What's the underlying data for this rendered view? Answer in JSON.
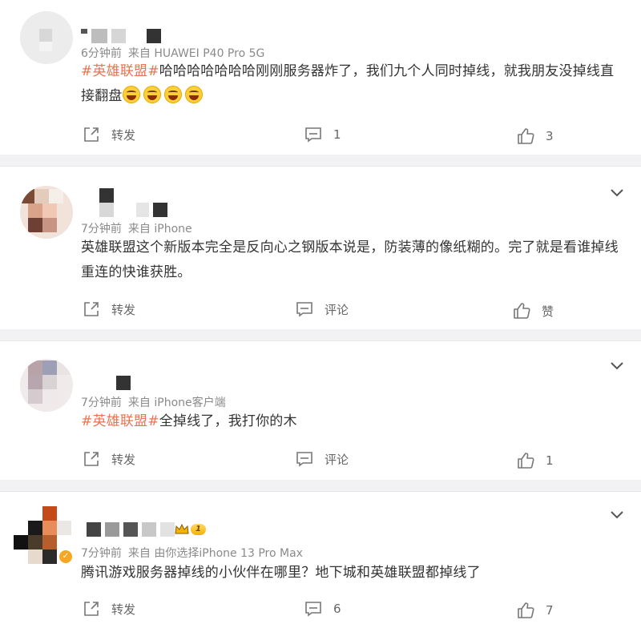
{
  "posts": [
    {
      "time": "6分钟前",
      "source": "来自 HUAWEI P40 Pro 5G",
      "hashtag": "#英雄联盟#",
      "text": "哈哈哈哈哈哈哈刚刚服务器炸了，我们九个人同时掉线，就我朋友没掉线直接翻盘",
      "repost_label": "转发",
      "comment_label": "1",
      "like_label": "3"
    },
    {
      "time": "7分钟前",
      "source": "来自 iPhone",
      "text": "英雄联盟这个新版本完全是反向心之钢版本说是，防装薄的像纸糊的。完了就是看谁掉线重连的快谁获胜。",
      "repost_label": "转发",
      "comment_label": "评论",
      "like_label": "赞"
    },
    {
      "time": "7分钟前",
      "source": "来自 iPhone客户端",
      "hashtag": "#英雄联盟#",
      "text": "全掉线了，我打你的木",
      "repost_label": "转发",
      "comment_label": "评论",
      "like_label": "1"
    },
    {
      "time": "7分钟前",
      "source": "来自 由你选择iPhone 13 Pro Max",
      "text": "腾讯游戏服务器掉线的小伙伴在哪里？地下城和英雄联盟都掉线了",
      "repost_label": "转发",
      "comment_label": "6",
      "like_label": "7",
      "level": "1"
    }
  ],
  "colors": {
    "hashtag": "#eb7350",
    "meta": "#8a8a8a",
    "background": "#f2f2f5"
  }
}
